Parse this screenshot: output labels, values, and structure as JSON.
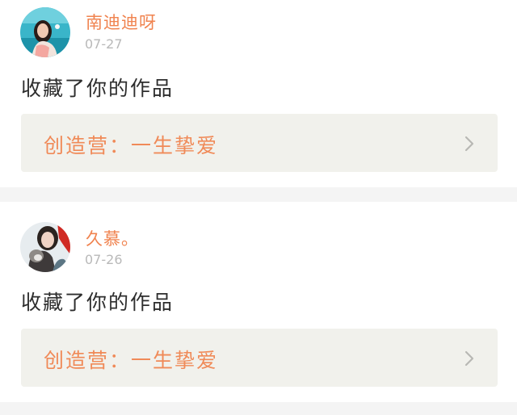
{
  "notifications": [
    {
      "user": "南迪迪呀",
      "date": "07-27",
      "action": "收藏了你的作品",
      "work": "创造营：一生挚爱",
      "avatar_icon": "user-avatar-pool-icon"
    },
    {
      "user": "久慕。",
      "date": "07-26",
      "action": "收藏了你的作品",
      "work": "创造营：一生挚爱",
      "avatar_icon": "user-avatar-dog-icon"
    }
  ],
  "colors": {
    "name": "#f0834f",
    "work_title": "#f08a58",
    "date": "#b9b9b9",
    "action": "#2d2d2d",
    "link_bg": "#f1f1ec",
    "divider": "#f4f4f4"
  },
  "icons": {
    "chevron": "chevron-right-icon"
  }
}
